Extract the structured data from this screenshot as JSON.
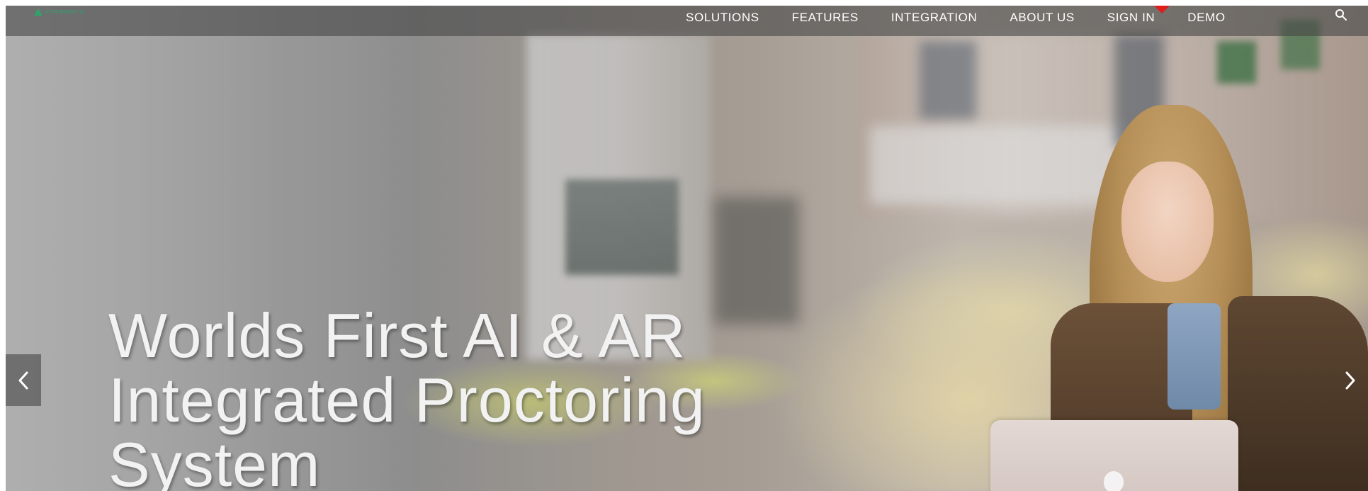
{
  "brand": {
    "logo_text": "ATTAINMENT.AI",
    "accent_color": "#2fa36b"
  },
  "nav": {
    "items": [
      {
        "label": "SOLUTIONS"
      },
      {
        "label": "FEATURES"
      },
      {
        "label": "INTEGRATION"
      },
      {
        "label": "ABOUT US"
      },
      {
        "label": "SIGN IN"
      },
      {
        "label": "DEMO"
      }
    ],
    "active_marker_color": "#e01d1d",
    "search_icon": "search-icon"
  },
  "hero": {
    "title_lines": [
      "Worlds First AI & AR",
      "Integrated Proctoring",
      "System"
    ]
  },
  "slider": {
    "prev_icon": "chevron-left-icon",
    "next_icon": "chevron-right-icon"
  }
}
